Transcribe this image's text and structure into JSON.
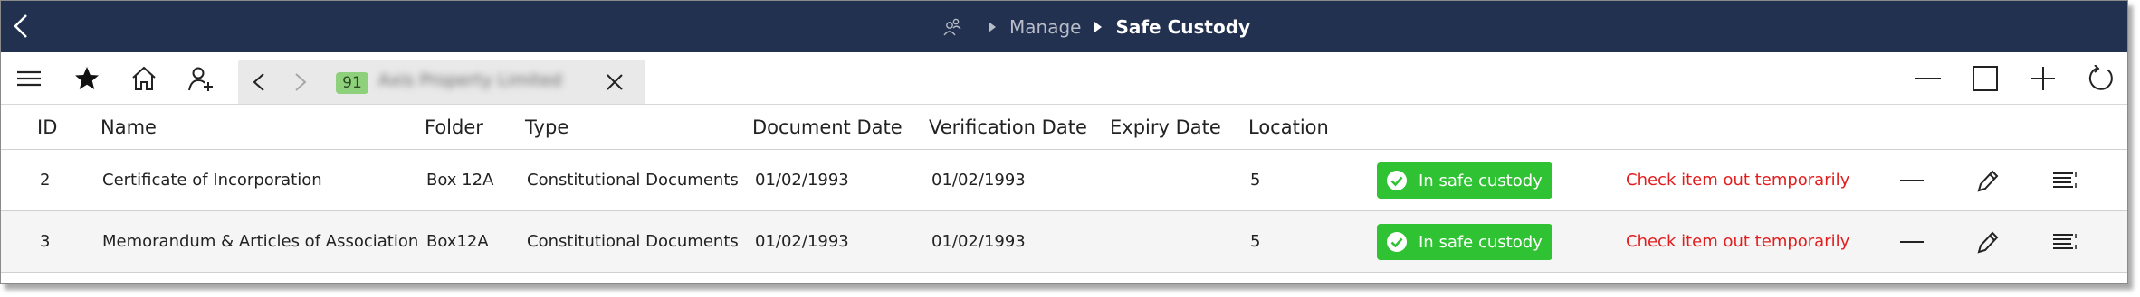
{
  "breadcrumb": {
    "section": "Manage",
    "current": "Safe Custody"
  },
  "tab": {
    "badge": "91",
    "title": "Axis Property Limited"
  },
  "icons": {
    "back": "chevron-left-icon",
    "breadcrumb_icon": "users-icon",
    "menu": "hamburger-menu-icon",
    "favorites": "star-icon",
    "home": "home-icon",
    "add_user": "add-user-icon",
    "minimize": "minimize-icon",
    "maximize": "maximize-icon",
    "add": "plus-icon",
    "refresh": "refresh-icon"
  },
  "colors": {
    "titlebar": "#223150",
    "status_green": "#2fc233",
    "checkout_red": "#e21d1d",
    "badge_green": "#8fd07c"
  },
  "table": {
    "headers": {
      "id": "ID",
      "name": "Name",
      "folder": "Folder",
      "type": "Type",
      "document_date": "Document Date",
      "verification_date": "Verification Date",
      "expiry_date": "Expiry Date",
      "location": "Location"
    },
    "rows": [
      {
        "id": "2",
        "name": "Certificate of Incorporation",
        "folder": "Box 12A",
        "type": "Constitutional Documents",
        "document_date": "01/02/1993",
        "verification_date": "01/02/1993",
        "expiry_date": "",
        "location": "5",
        "status": "In safe custody",
        "action": "Check item out temporarily"
      },
      {
        "id": "3",
        "name": "Memorandum & Articles of Association",
        "folder": "Box12A",
        "type": "Constitutional Documents",
        "document_date": "01/02/1993",
        "verification_date": "01/02/1993",
        "expiry_date": "",
        "location": "5",
        "status": "In safe custody",
        "action": "Check item out temporarily"
      }
    ]
  }
}
